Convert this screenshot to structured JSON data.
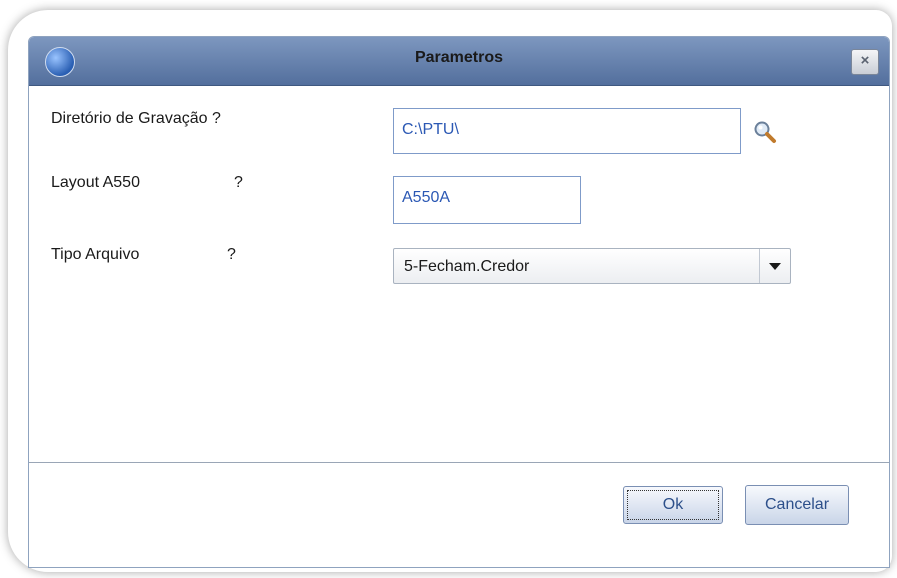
{
  "window": {
    "title": "Parametros",
    "close_glyph": "×",
    "app_icon": "globe-icon"
  },
  "form": {
    "fields": [
      {
        "label": "Diretório de Gravação ?",
        "value": "C:\\PTU\\"
      },
      {
        "label": "Layout A550",
        "question": "?",
        "value": "A550A"
      },
      {
        "label": "Tipo Arquivo",
        "question": "?",
        "value": "5-Fecham.Credor"
      }
    ],
    "search_icon": "search-icon"
  },
  "buttons": {
    "ok": "Ok",
    "cancel": "Cancelar"
  },
  "colors": {
    "titlebar": "#536f9d",
    "field_text": "#2b58b4",
    "button_text": "#2c4f8a"
  }
}
